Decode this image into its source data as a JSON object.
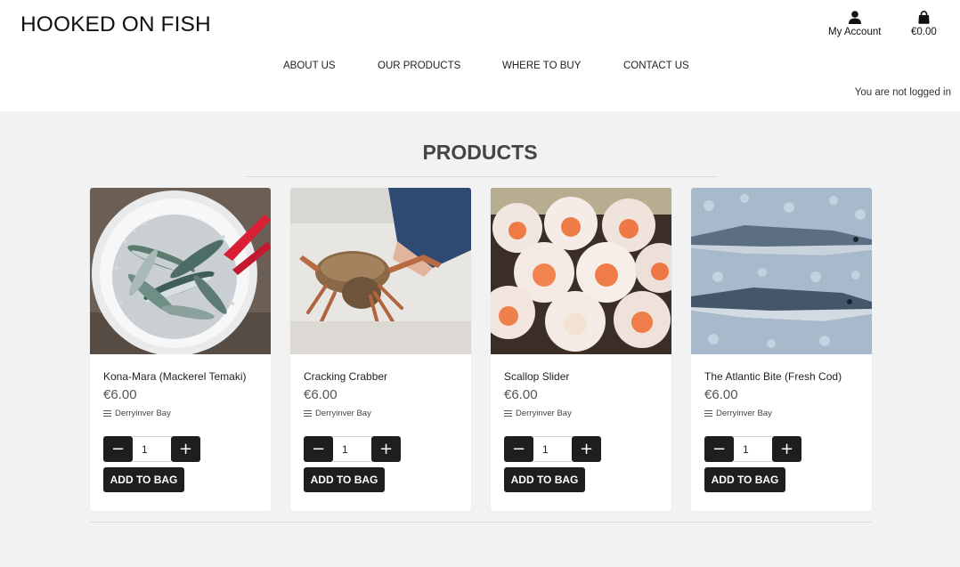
{
  "header": {
    "logo": "HOOKED ON FISH",
    "account_label": "My Account",
    "bag_total": "€0.00",
    "login_status": "You are not logged in"
  },
  "nav": [
    {
      "label": "ABOUT US"
    },
    {
      "label": "OUR PRODUCTS"
    },
    {
      "label": "WHERE TO BUY"
    },
    {
      "label": "CONTACT US"
    }
  ],
  "page": {
    "title": "PRODUCTS"
  },
  "products": [
    {
      "name": "Kona-Mara (Mackerel Temaki)",
      "price": "€6.00",
      "location": "Derryinver Bay",
      "quantity": "1",
      "add_label": "ADD TO BAG",
      "image": "mackerel-in-white-basket"
    },
    {
      "name": "Cracking Crabber",
      "price": "€6.00",
      "location": "Derryinver Bay",
      "quantity": "1",
      "add_label": "ADD TO BAG",
      "image": "crab-held-in-hand"
    },
    {
      "name": "Scallop Slider",
      "price": "€6.00",
      "location": "Derryinver Bay",
      "quantity": "1",
      "add_label": "ADD TO BAG",
      "image": "scallops-in-shells"
    },
    {
      "name": "The Atlantic Bite (Fresh Cod)",
      "price": "€6.00",
      "location": "Derryinver Bay",
      "quantity": "1",
      "add_label": "ADD TO BAG",
      "image": "cod-on-ice"
    }
  ],
  "icons": {
    "account": "user-icon",
    "bag": "shopping-bag-icon",
    "minus": "minus-icon",
    "plus": "plus-icon",
    "location": "list-icon"
  },
  "colors": {
    "button": "#1e1e1e",
    "page_background": "#f2f2f2",
    "card_background": "#ffffff"
  }
}
